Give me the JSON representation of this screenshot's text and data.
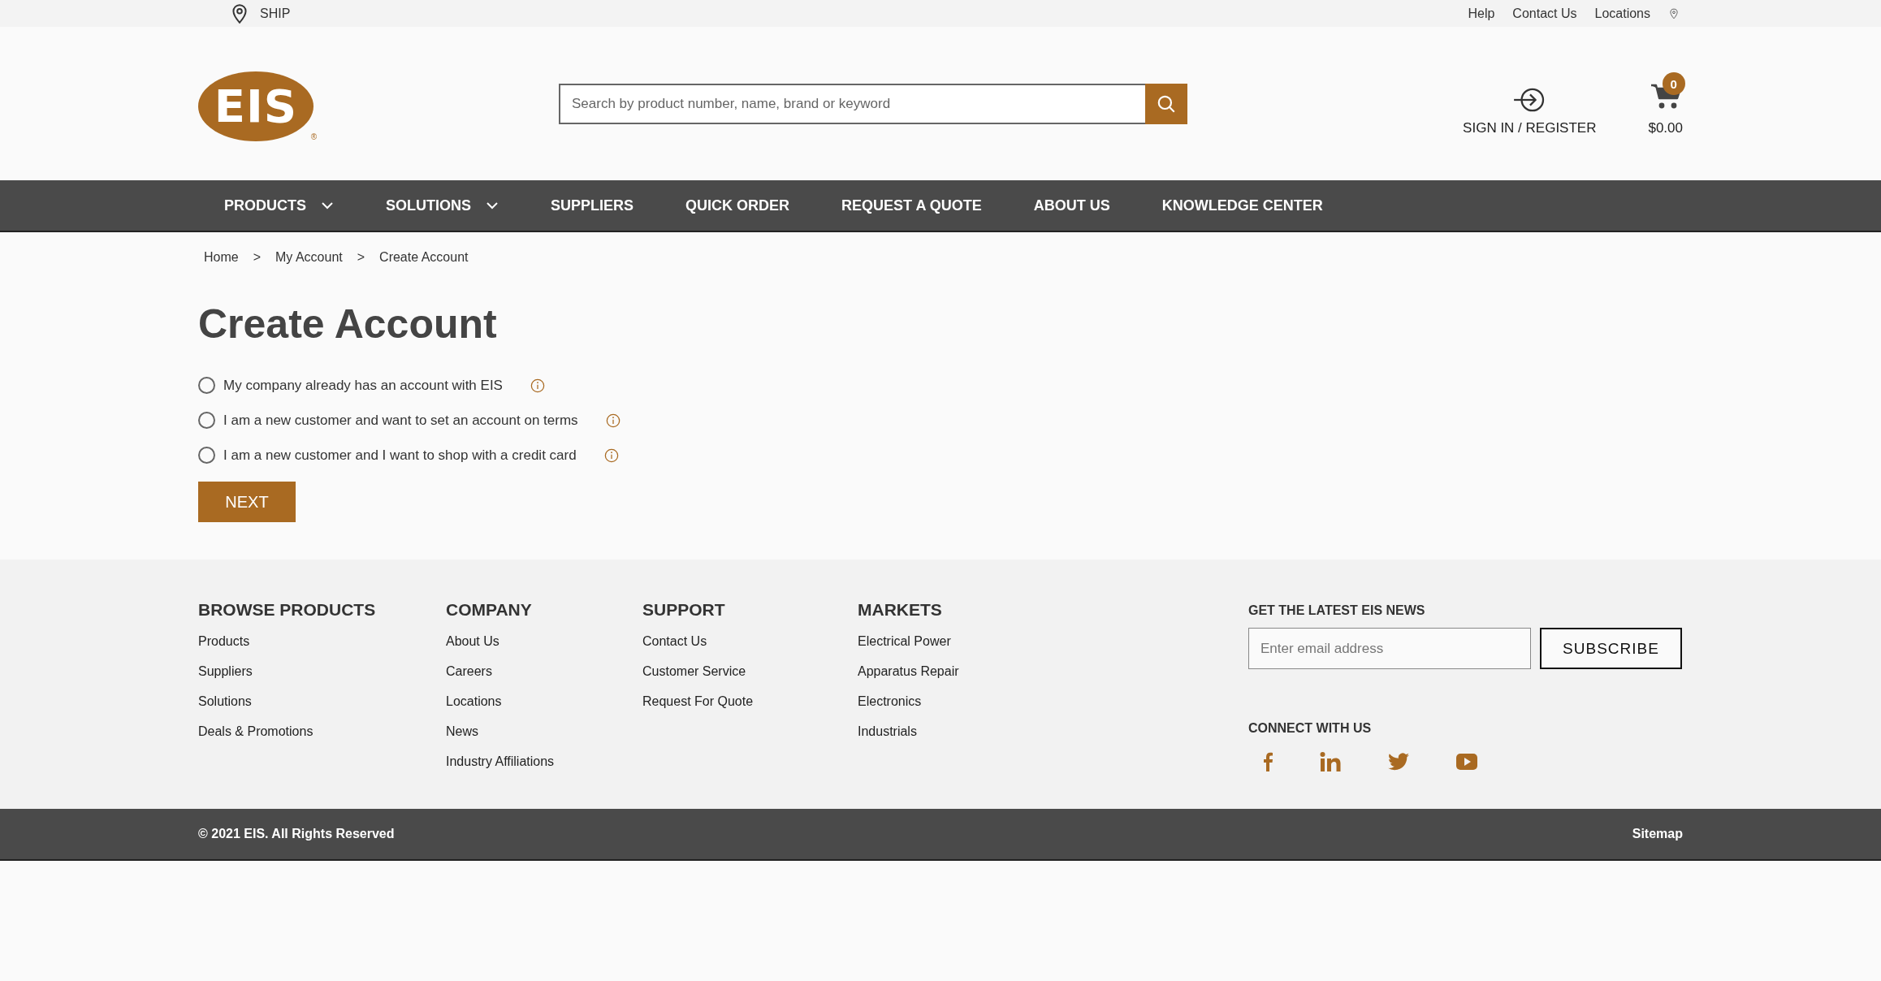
{
  "top_bar": {
    "ship_label": "SHIP",
    "links": [
      "Help",
      "Contact Us",
      "Locations"
    ]
  },
  "header": {
    "logo_text": "EIS",
    "logo_mark": "®",
    "search": {
      "placeholder": "Search by product number, name, brand or keyword"
    },
    "sign_in": "SIGN IN / REGISTER",
    "cart": {
      "count": "0",
      "total": "$0.00"
    }
  },
  "nav": [
    {
      "label": "PRODUCTS",
      "dropdown": true
    },
    {
      "label": "SOLUTIONS",
      "dropdown": true
    },
    {
      "label": "SUPPLIERS",
      "dropdown": false
    },
    {
      "label": "QUICK ORDER",
      "dropdown": false
    },
    {
      "label": "REQUEST A QUOTE",
      "dropdown": false
    },
    {
      "label": "ABOUT US",
      "dropdown": false
    },
    {
      "label": "KNOWLEDGE CENTER",
      "dropdown": false
    }
  ],
  "breadcrumb": [
    "Home",
    "My Account",
    "Create Account"
  ],
  "breadcrumb_separator": ">",
  "title": "Create Account",
  "options": [
    {
      "label": "My company already has an account with EIS",
      "selected": false
    },
    {
      "label": "I am a new customer and want to set an account on terms",
      "selected": false
    },
    {
      "label": "I am a new customer and I want to shop with a credit card",
      "selected": false
    }
  ],
  "next_button": "NEXT",
  "footer": {
    "columns": [
      {
        "heading": "BROWSE PRODUCTS",
        "links": [
          "Products",
          "Suppliers",
          "Solutions",
          "Deals & Promotions"
        ]
      },
      {
        "heading": "COMPANY",
        "links": [
          "About Us",
          "Careers",
          "Locations",
          "News",
          "Industry Affiliations"
        ]
      },
      {
        "heading": "SUPPORT",
        "links": [
          "Contact Us",
          "Customer Service",
          "Request For Quote"
        ]
      },
      {
        "heading": "MARKETS",
        "links": [
          "Electrical Power",
          "Apparatus Repair",
          "Electronics",
          "Industrials"
        ]
      }
    ],
    "newsletter": {
      "heading": "GET THE LATEST EIS NEWS",
      "placeholder": "Enter email address",
      "button": "SUBSCRIBE"
    },
    "connect": {
      "heading": "CONNECT WITH US",
      "icons": [
        {
          "kind": "facebook"
        },
        {
          "kind": "linkedin"
        },
        {
          "kind": "twitter"
        },
        {
          "kind": "youtube"
        }
      ]
    }
  },
  "bottom_bar": {
    "copyright": "© 2021 EIS. All Rights Reserved",
    "sitemap": "Sitemap"
  }
}
